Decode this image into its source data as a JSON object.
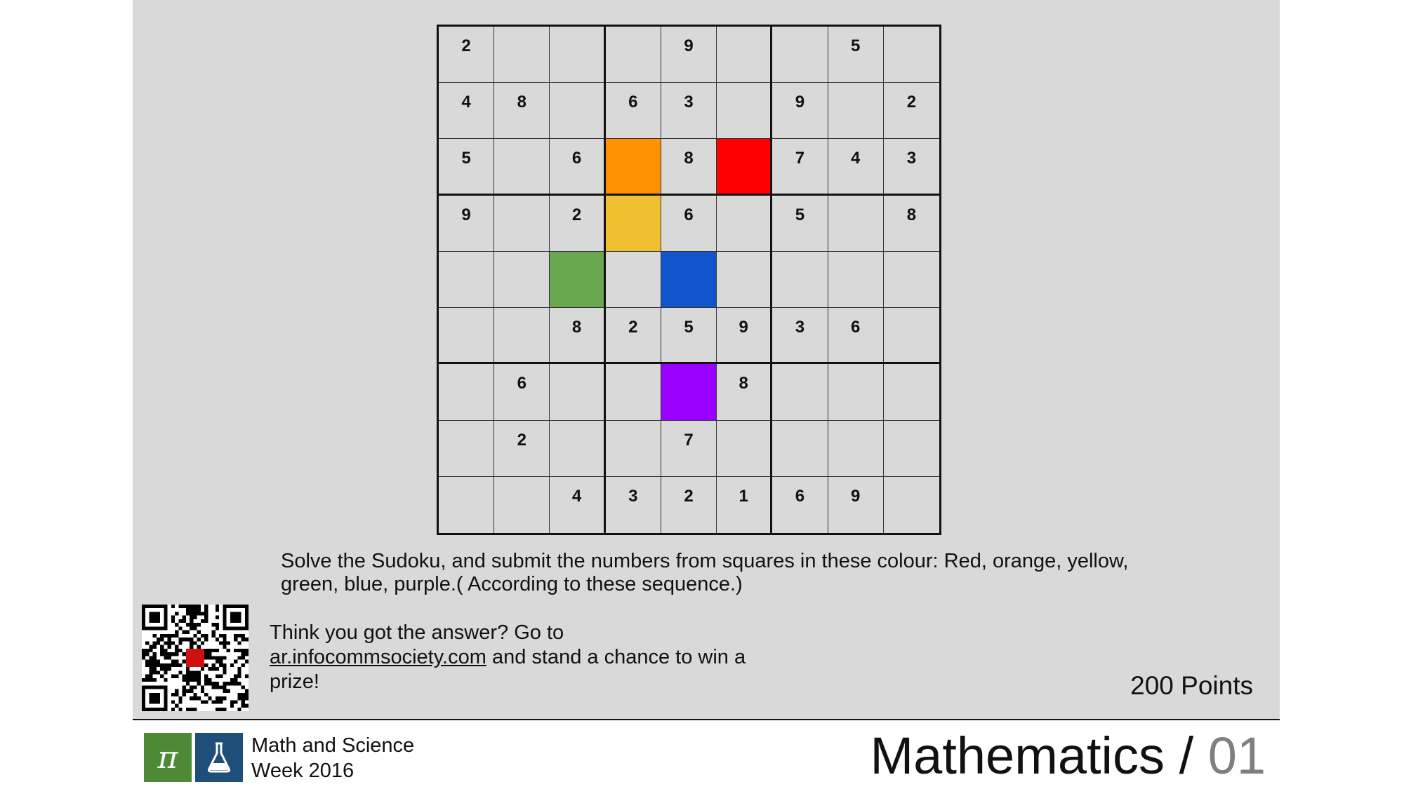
{
  "grid": [
    [
      "2",
      "",
      "",
      "",
      "9",
      "",
      "",
      "5",
      ""
    ],
    [
      "4",
      "8",
      "",
      "6",
      "3",
      "",
      "9",
      "",
      "2"
    ],
    [
      "5",
      "",
      "6",
      "",
      "8",
      "",
      "7",
      "4",
      "3"
    ],
    [
      "9",
      "",
      "2",
      "",
      "6",
      "",
      "5",
      "",
      "8"
    ],
    [
      "",
      "",
      "",
      "",
      "",
      "",
      "",
      "",
      ""
    ],
    [
      "",
      "",
      "8",
      "2",
      "5",
      "9",
      "3",
      "6",
      ""
    ],
    [
      "",
      "6",
      "",
      "",
      "",
      "8",
      "",
      "",
      ""
    ],
    [
      "",
      "2",
      "",
      "",
      "7",
      "",
      "",
      "",
      ""
    ],
    [
      "",
      "",
      "4",
      "3",
      "2",
      "1",
      "6",
      "9",
      ""
    ]
  ],
  "highlights": [
    {
      "name": "orange",
      "row": 2,
      "col": 3,
      "color": "#ff9200"
    },
    {
      "name": "red",
      "row": 2,
      "col": 5,
      "color": "#ff0000"
    },
    {
      "name": "yellow",
      "row": 3,
      "col": 3,
      "color": "#f0c030"
    },
    {
      "name": "green",
      "row": 4,
      "col": 2,
      "color": "#6aa84f"
    },
    {
      "name": "blue",
      "row": 4,
      "col": 4,
      "color": "#1155cc"
    },
    {
      "name": "purple",
      "row": 6,
      "col": 4,
      "color": "#9900ff"
    }
  ],
  "instructions": "Solve the Sudoku, and submit the numbers from squares in these colour: Red, orange, yellow, green, blue, purple.( According to these sequence.)",
  "answer": {
    "lead": "Think you got the answer? Go to",
    "link": "ar.infocommsociety.com",
    "tail": "and stand a chance to win a prize!"
  },
  "points": "200 Points",
  "footer": {
    "logo_pi": "π",
    "event_line1": "Math and Science",
    "event_line2": "Week 2016",
    "subject": "Mathematics",
    "separator": "/",
    "number": "01"
  },
  "colors": {
    "background": "#d9d9d9",
    "logo_green": "#4e8a35",
    "logo_blue": "#1f4e79",
    "number_grey": "#7f7f7f"
  },
  "icons": [
    "qr-code-icon",
    "flask-icon"
  ]
}
